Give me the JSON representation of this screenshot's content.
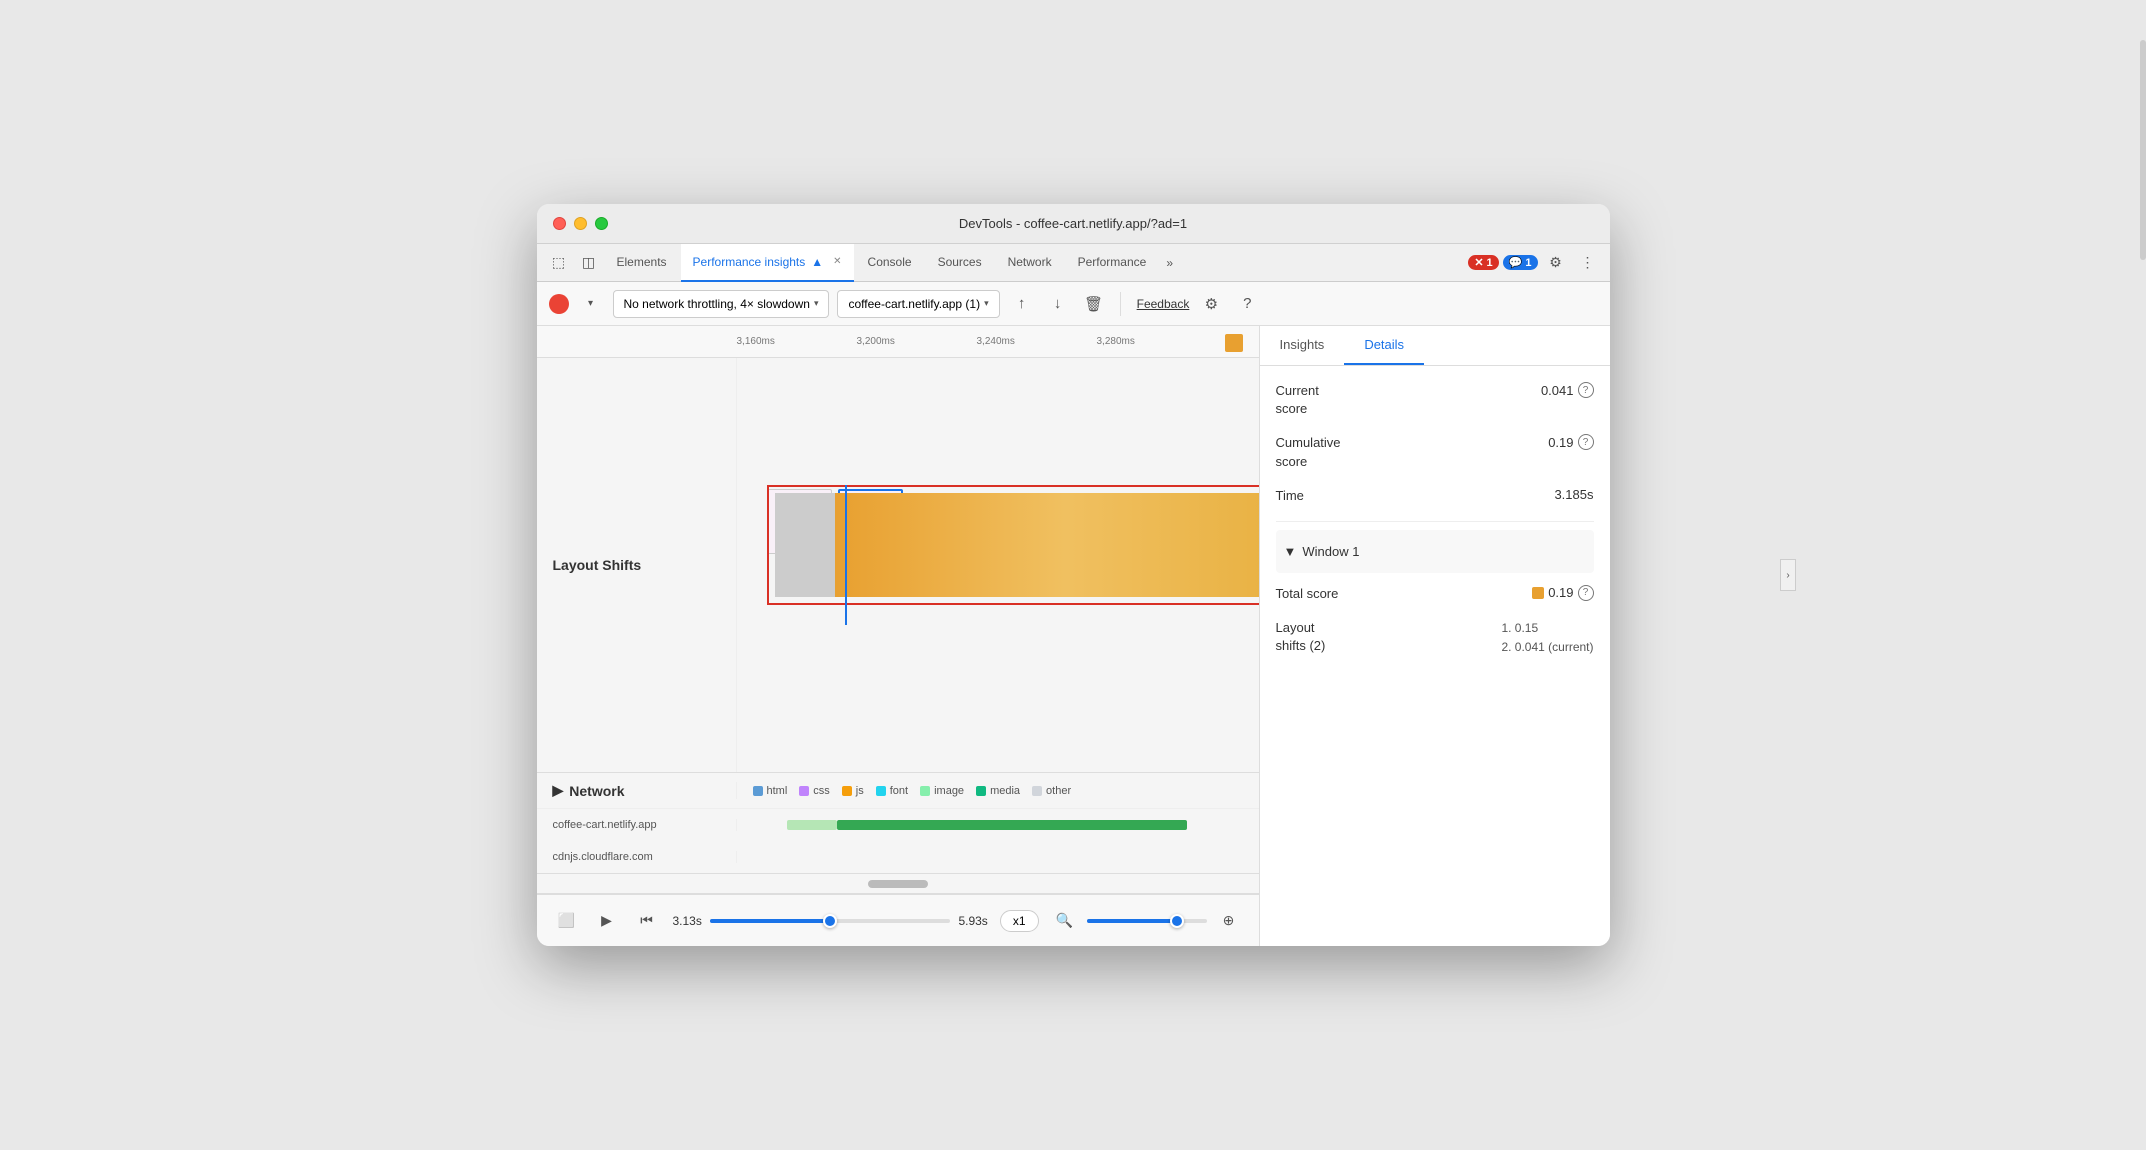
{
  "window": {
    "title": "DevTools - coffee-cart.netlify.app/?ad=1"
  },
  "tabs": {
    "items": [
      {
        "label": "Elements",
        "active": false
      },
      {
        "label": "Performance insights",
        "active": true
      },
      {
        "label": "Console",
        "active": false
      },
      {
        "label": "Sources",
        "active": false
      },
      {
        "label": "Network",
        "active": false
      },
      {
        "label": "Performance",
        "active": false
      }
    ],
    "more": "»",
    "errors_badge": "1",
    "messages_badge": "1"
  },
  "toolbar": {
    "throttling_label": "No network throttling, 4× slowdown",
    "profile_label": "coffee-cart.netlify.app (1)",
    "feedback_label": "Feedback"
  },
  "timeline": {
    "markers": [
      "3,160ms",
      "3,200ms",
      "3,240ms",
      "3,280ms"
    ]
  },
  "layout_shifts": {
    "label": "Layout Shifts"
  },
  "network": {
    "label": "Network",
    "legend": [
      {
        "type": "html",
        "color": "#5b9bd5"
      },
      {
        "type": "css",
        "color": "#c084fc"
      },
      {
        "type": "js",
        "color": "#f59e0b"
      },
      {
        "type": "font",
        "color": "#22d3ee"
      },
      {
        "type": "image",
        "color": "#86efac"
      },
      {
        "type": "media",
        "color": "#10b981"
      },
      {
        "type": "other",
        "color": "#d1d5db"
      }
    ],
    "rows": [
      {
        "label": "coffee-cart.netlify.app"
      },
      {
        "label": "cdnjs.cloudflare.com"
      }
    ]
  },
  "bottom_toolbar": {
    "time_start": "3.13s",
    "time_end": "5.93s",
    "speed": "x1"
  },
  "right_panel": {
    "tabs": [
      {
        "label": "Insights",
        "active": false
      },
      {
        "label": "Details",
        "active": true
      }
    ],
    "metrics": [
      {
        "label": "Current\nscore",
        "value": "0.041"
      },
      {
        "label": "Cumulative\nscore",
        "value": "0.19"
      },
      {
        "label": "Time",
        "value": "3.185s"
      }
    ],
    "window_section": {
      "label": "Window 1",
      "total_score_label": "Total score",
      "total_score_value": "0.19",
      "layout_shifts_label": "Layout\nshifts (2)",
      "layout_shifts_value": "1. 0.15\n2. 0.041 (current)"
    }
  }
}
